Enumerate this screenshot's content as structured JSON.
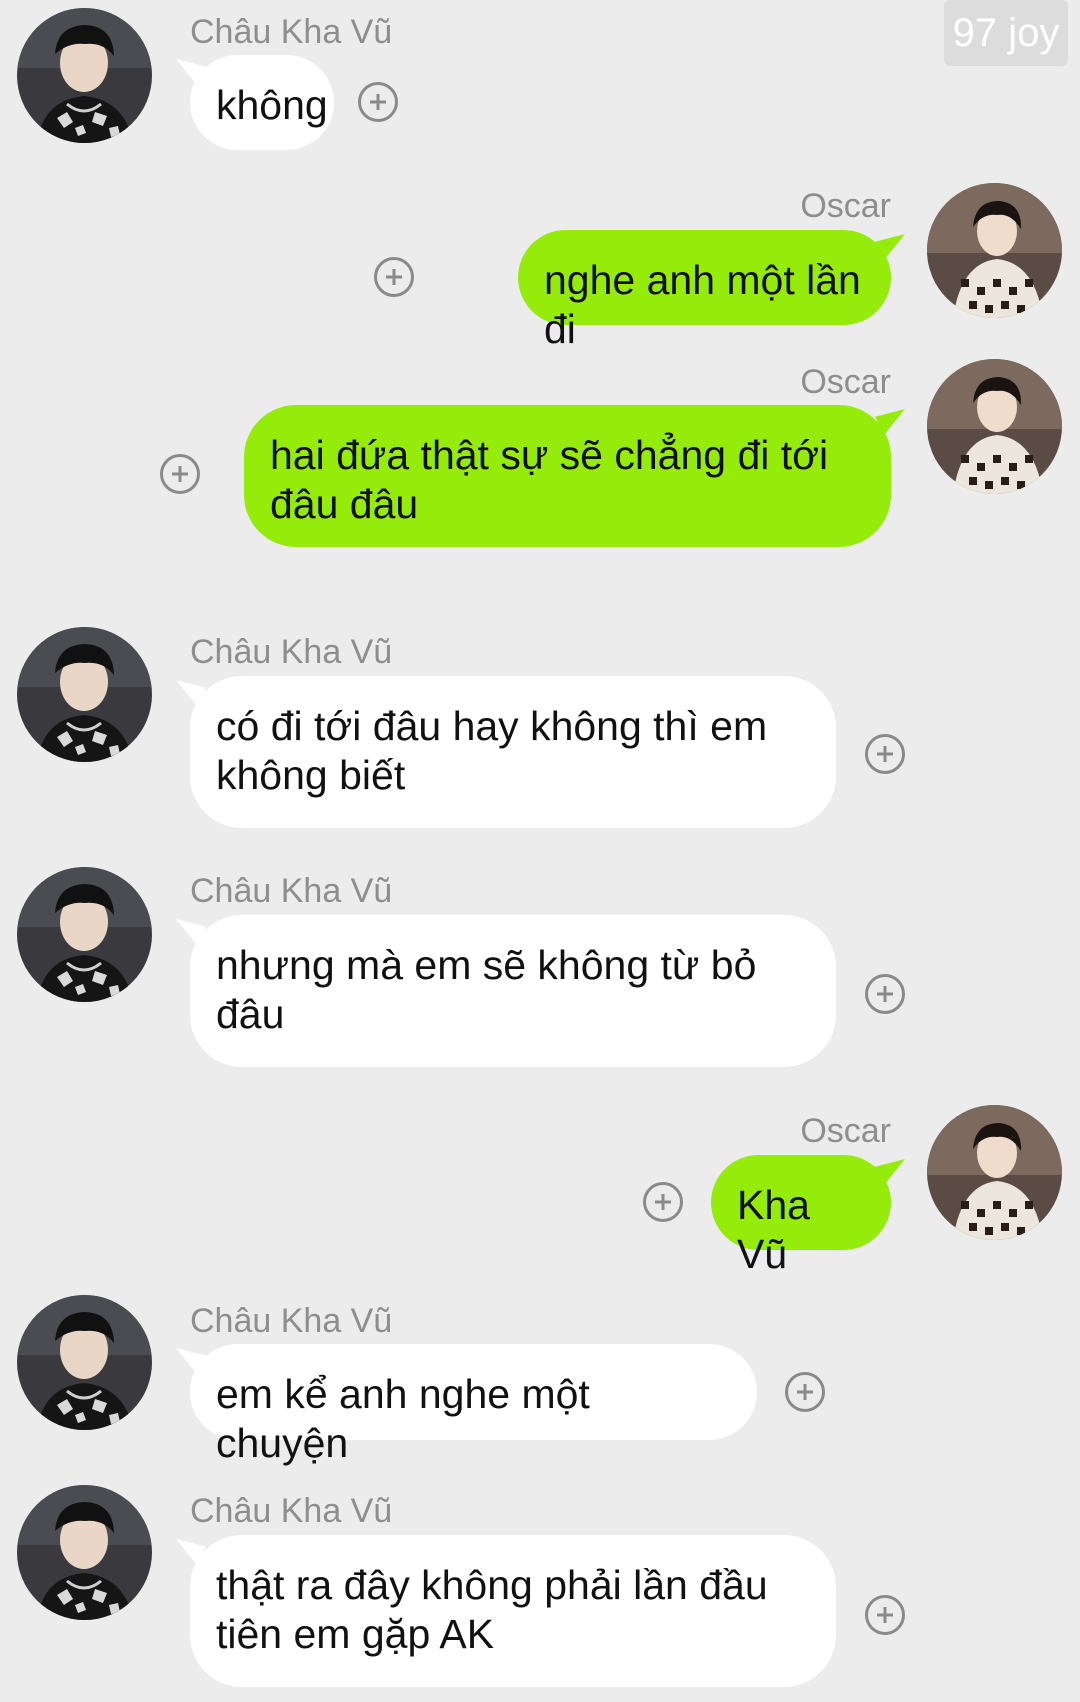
{
  "watermark": "97 joy",
  "messages": [
    {
      "side": "in",
      "sender": "Châu Kha Vũ",
      "text": "không"
    },
    {
      "side": "out",
      "sender": "Oscar",
      "text": "nghe anh một lần đi"
    },
    {
      "side": "out",
      "sender": "Oscar",
      "text": "hai đứa thật sự sẽ chẳng đi tới đâu đâu"
    },
    {
      "side": "in",
      "sender": "Châu Kha Vũ",
      "text": "có đi tới đâu hay không thì em không biết"
    },
    {
      "side": "in",
      "sender": "Châu Kha Vũ",
      "text": "nhưng mà em sẽ không từ bỏ đâu"
    },
    {
      "side": "out",
      "sender": "Oscar",
      "text": "Kha Vũ"
    },
    {
      "side": "in",
      "sender": "Châu Kha Vũ",
      "text": "em kể anh nghe một chuyện"
    },
    {
      "side": "in",
      "sender": "Châu Kha Vũ",
      "text": "thật ra đây không phải lần đầu tiên em gặp AK"
    }
  ],
  "icons": {
    "add_reaction": "plus-circle-icon",
    "avatar_in": "avatar-chau-kha-vu",
    "avatar_out": "avatar-oscar"
  },
  "colors": {
    "background": "#ececec",
    "incoming_bubble": "#ffffff",
    "outgoing_bubble": "#95ec0b",
    "sender_name": "#8e8e8e"
  }
}
